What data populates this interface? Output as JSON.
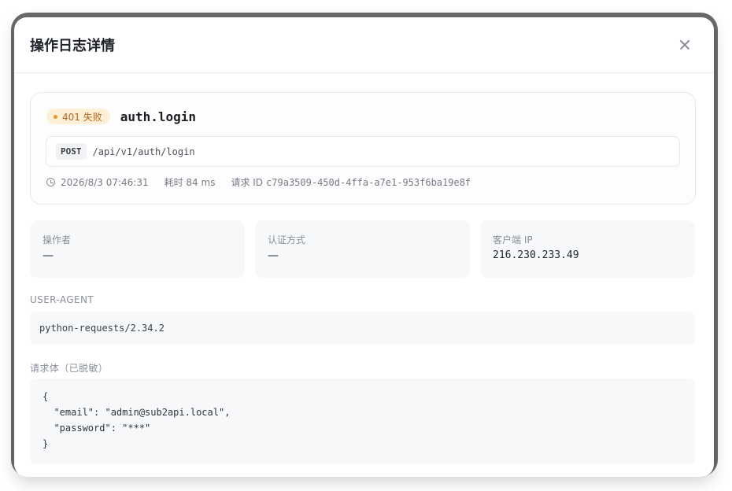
{
  "modal": {
    "title": "操作日志详情"
  },
  "summary": {
    "status_badge": "401 失败",
    "action": "auth.login",
    "method": "POST",
    "path": "/api/v1/auth/login",
    "timestamp": "2026/8/3 07:46:31",
    "duration": "耗时 84 ms",
    "request_id_label": "请求 ID",
    "request_id": "c79a3509-450d-4ffa-a7e1-953f6ba19e8f"
  },
  "info_cards": [
    {
      "label": "操作者",
      "value": "—"
    },
    {
      "label": "认证方式",
      "value": "—"
    },
    {
      "label": "客户端 IP",
      "value": "216.230.233.49"
    }
  ],
  "user_agent": {
    "label": "USER-AGENT",
    "value": "python-requests/2.34.2"
  },
  "request_body": {
    "label": "请求体（已脱敏）",
    "lines": [
      "{",
      "  \"email\": \"admin@sub2api.local\",",
      "  \"password\": \"***\"",
      "}"
    ]
  },
  "colors": {
    "status_badge_bg": "#fdf0d6",
    "status_badge_text": "#b3661b",
    "status_dot": "#e39a2c"
  },
  "icons": [
    "close-icon",
    "clock-icon",
    "status-dot-icon"
  ]
}
